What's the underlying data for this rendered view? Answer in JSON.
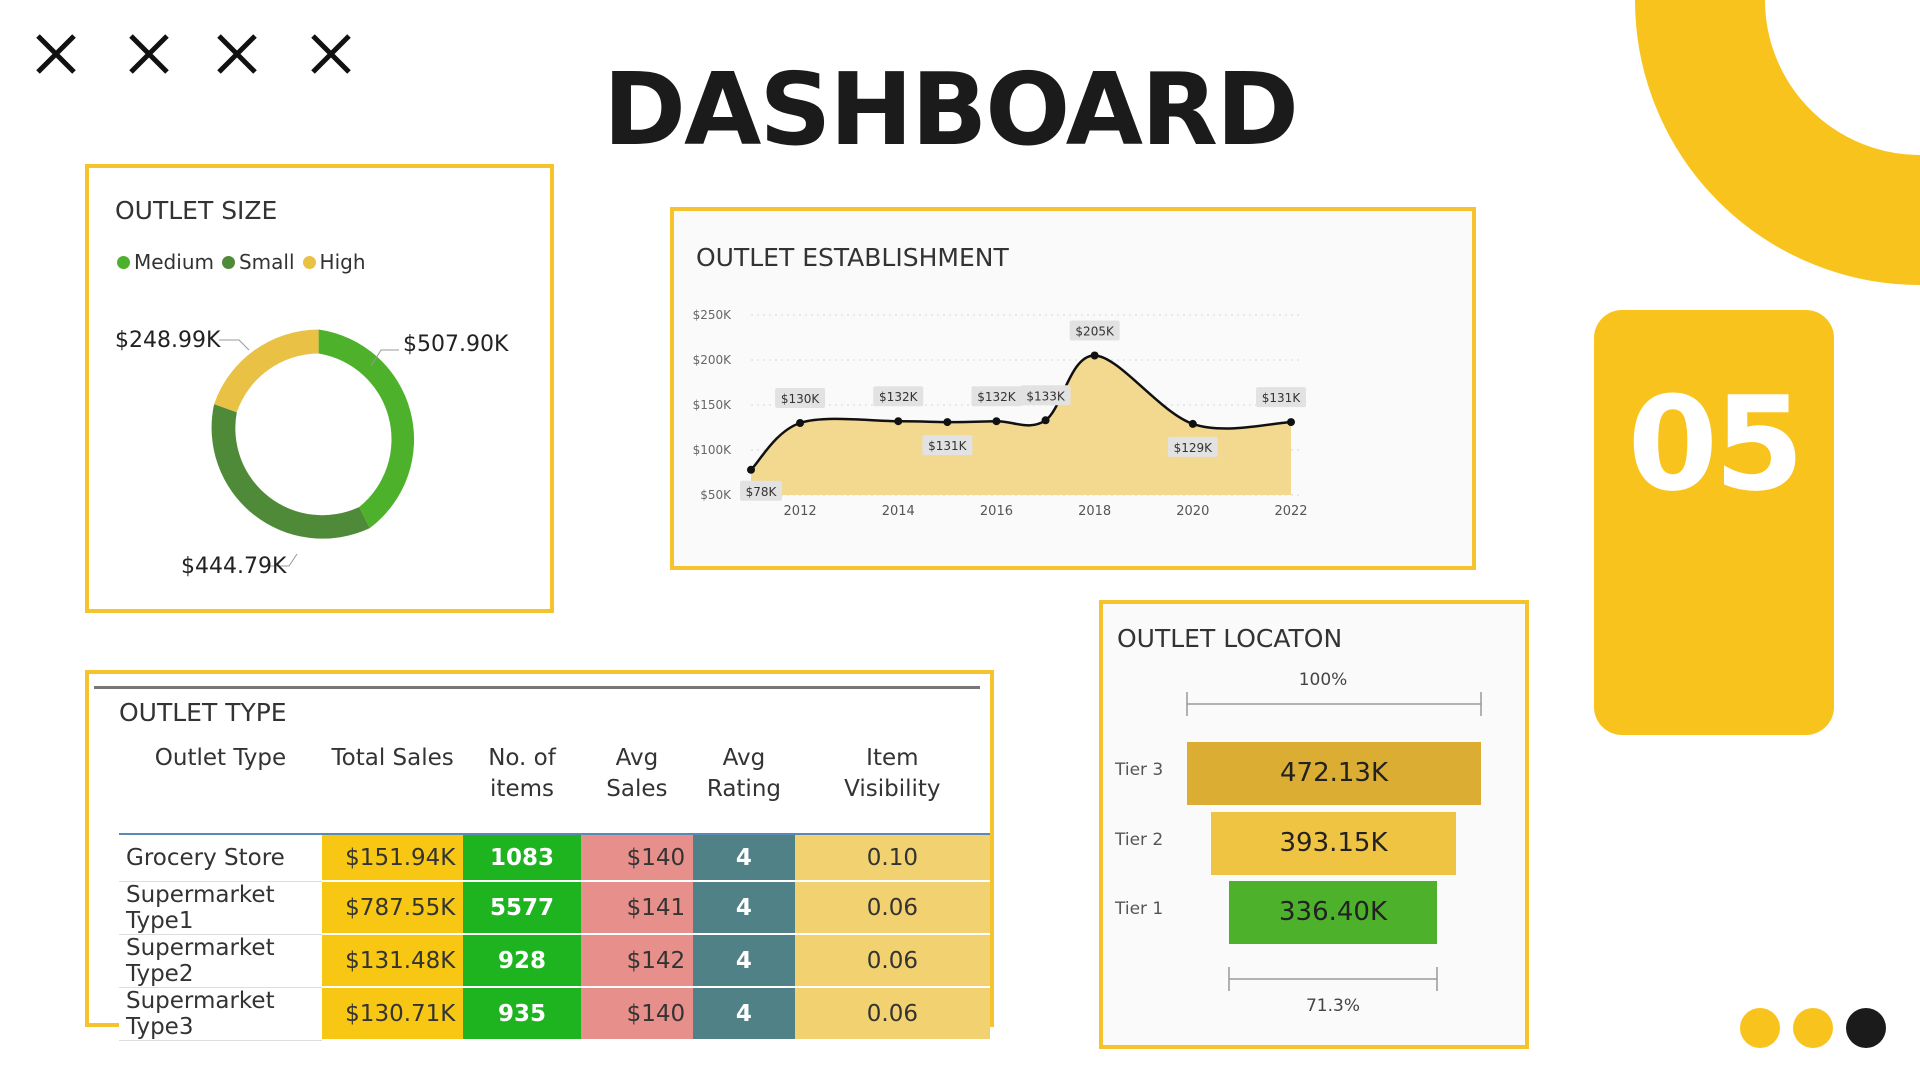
{
  "header": {
    "title": "DASHBOARD",
    "slide_number": "05"
  },
  "colors": {
    "accent_yellow": "#f9c31e",
    "panel_border": "#f4c32d",
    "dark": "#1b1b1b"
  },
  "decor": {
    "close_icons": [
      "close-icon",
      "close-icon",
      "close-icon",
      "close-icon"
    ],
    "dots": [
      "#f9c31e",
      "#f9c31e",
      "#1b1b1b"
    ]
  },
  "outlet_size": {
    "title": "OUTLET SIZE",
    "legend": [
      {
        "label": "Medium",
        "color": "#4eb12c"
      },
      {
        "label": "Small",
        "color": "#4f8a38"
      },
      {
        "label": "High",
        "color": "#e9c145"
      }
    ],
    "labels": {
      "medium": "$507.90K",
      "small": "$444.79K",
      "high": "$248.99K"
    }
  },
  "chart_data": {
    "type": "area",
    "title": "OUTLET ESTABLISHMENT",
    "x": [
      2011,
      2012,
      2014,
      2015,
      2016,
      2017,
      2018,
      2020,
      2022
    ],
    "values": [
      78,
      130,
      132,
      131,
      132,
      133,
      205,
      129,
      131
    ],
    "value_labels": [
      "$78K",
      "$130K",
      "$132K",
      "$131K",
      "$132K",
      "$133K",
      "$205K",
      "$129K",
      "$131K"
    ],
    "x_ticks": [
      "2012",
      "2014",
      "2016",
      "2018",
      "2020",
      "2022"
    ],
    "y_ticks": [
      "$50K",
      "$100K",
      "$150K",
      "$200K",
      "$250K"
    ],
    "ylim": [
      50,
      250
    ],
    "xlim": [
      2011,
      2022
    ],
    "grid": true,
    "fill_color": "#f2d98f",
    "line_color": "#111111"
  },
  "outlet_type": {
    "title": "OUTLET TYPE",
    "columns": [
      "Outlet Type",
      "Total Sales",
      "No. of items",
      "Avg Sales",
      "Avg Rating",
      "Item Visibility"
    ],
    "rows": [
      {
        "type": "Grocery Store",
        "total_sales": "$151.94K",
        "items": "1083",
        "avg_sales": "$140",
        "rating": "4",
        "visibility": "0.10"
      },
      {
        "type": "Supermarket Type1",
        "total_sales": "$787.55K",
        "items": "5577",
        "avg_sales": "$141",
        "rating": "4",
        "visibility": "0.06"
      },
      {
        "type": "Supermarket Type2",
        "total_sales": "$131.48K",
        "items": "928",
        "avg_sales": "$142",
        "rating": "4",
        "visibility": "0.06"
      },
      {
        "type": "Supermarket Type3",
        "total_sales": "$130.71K",
        "items": "935",
        "avg_sales": "$140",
        "rating": "4",
        "visibility": "0.06"
      }
    ]
  },
  "outlet_location": {
    "title": "OUTLET LOCATON",
    "top_pct": "100%",
    "bottom_pct": "71.3%",
    "tiers": [
      {
        "label": "Tier 3",
        "value": "472.13K",
        "color": "#dbad33"
      },
      {
        "label": "Tier 2",
        "value": "393.15K",
        "color": "#f0c443"
      },
      {
        "label": "Tier 1",
        "value": "336.40K",
        "color": "#4eb12c"
      }
    ]
  }
}
